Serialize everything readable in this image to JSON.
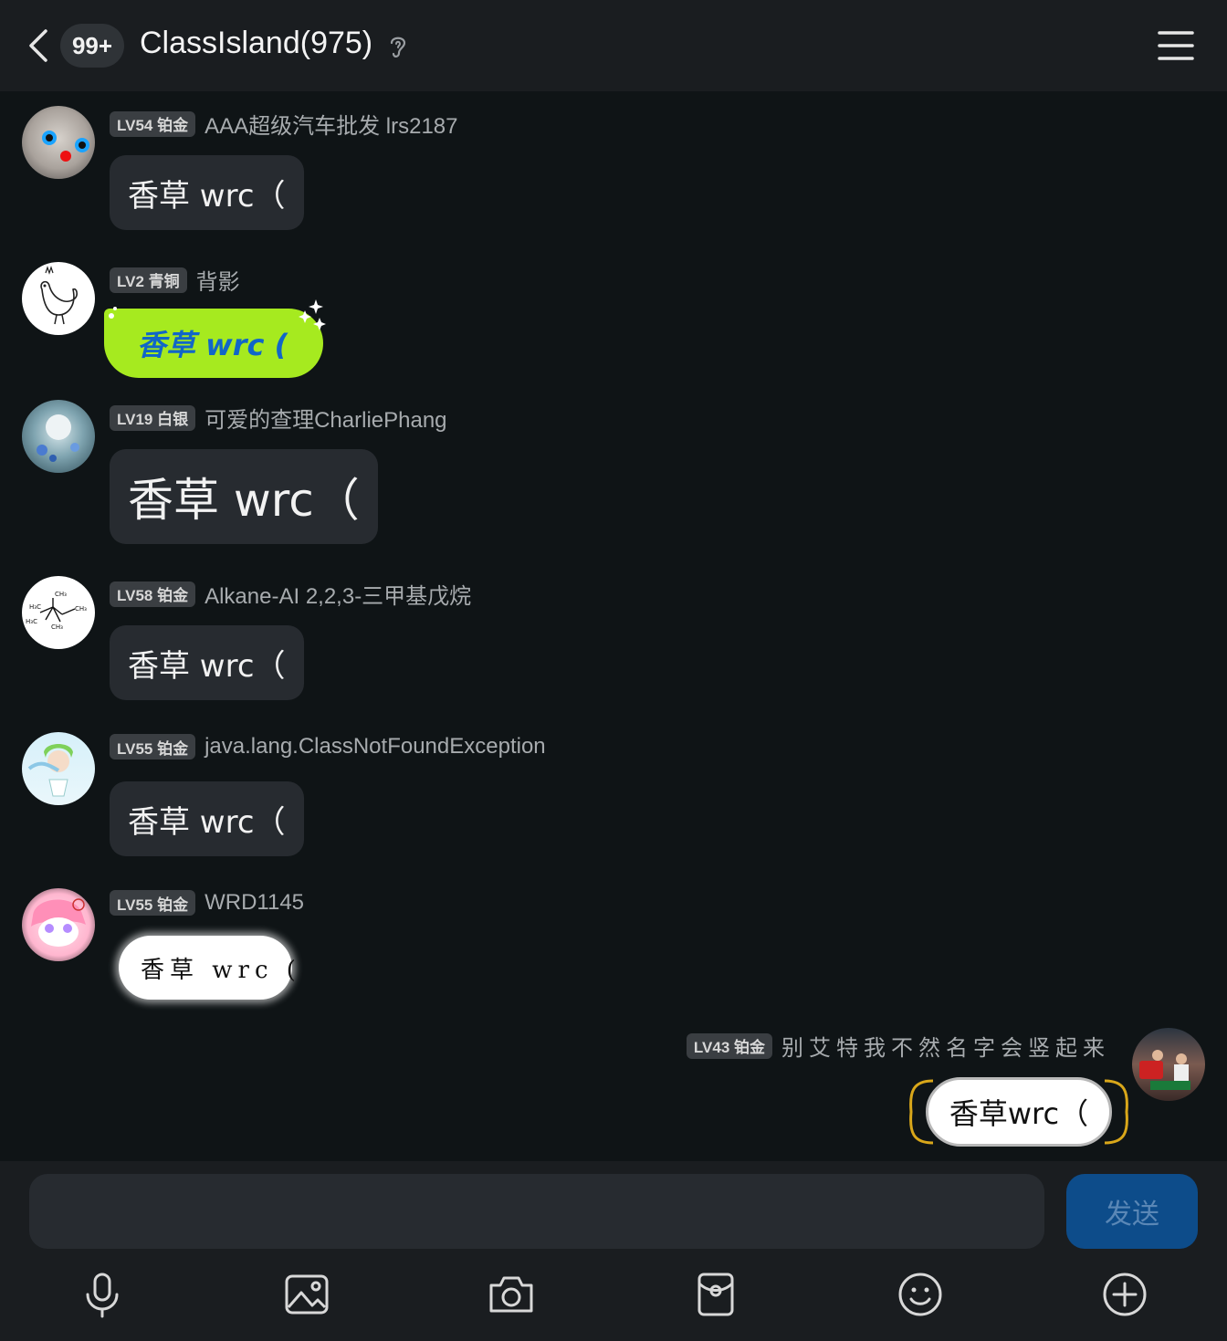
{
  "header": {
    "unread_badge": "99+",
    "title": "ClassIsland(975)"
  },
  "messages": [
    {
      "level": "LV54 铂金",
      "nickname": "AAA超级汽车批发 lrs2187",
      "text": "香草 wrc（"
    },
    {
      "level": "LV2 青铜",
      "nickname": "背影",
      "text": "香草 wrc ("
    },
    {
      "level": "LV19 白银",
      "nickname": "可爱的查理CharliePhang",
      "text": "香草 wrc（"
    },
    {
      "level": "LV58 铂金",
      "nickname": "Alkane-AI 2,2,3-三甲基戊烷",
      "text": "香草 wrc（"
    },
    {
      "level": "LV55 铂金",
      "nickname": "java.lang.ClassNotFoundException",
      "text": "香草 wrc（"
    },
    {
      "level": "LV55 铂金",
      "nickname": "WRD1145",
      "text": "香草 wrc ("
    }
  ],
  "self_message": {
    "level": "LV43 铂金",
    "nickname": "别艾特我不然名字会竖起来",
    "text": "香草wrc（"
  },
  "composer": {
    "input_value": "",
    "send_label": "发送"
  },
  "toolbar": {
    "icons": [
      "microphone-icon",
      "image-icon",
      "camera-icon",
      "red-packet-icon",
      "emoji-icon",
      "plus-icon"
    ]
  },
  "colors": {
    "background": "#0f1416",
    "bubble": "#272b30",
    "green_bubble": "#a6ea1f",
    "green_bubble_text": "#1166c8",
    "send_button": "#0d4c8a"
  }
}
